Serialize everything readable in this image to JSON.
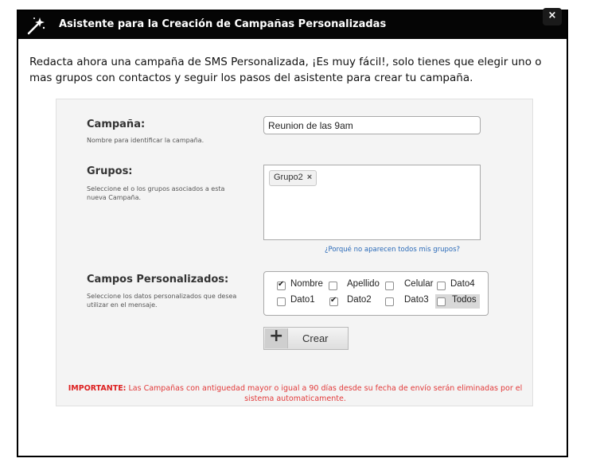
{
  "dialog": {
    "title": "Asistente para la Creación de Campañas Personalizadas",
    "close_label": "×"
  },
  "intro": "Redacta ahora una campaña de SMS Personalizada, ¡Es muy fácil!, solo tienes que elegir uno o mas grupos con contactos y seguir los pasos del asistente para crear tu campaña.",
  "form": {
    "campaign": {
      "label": "Campaña:",
      "help": "Nombre para identificar la campaña.",
      "value": "Reunion de las 9am"
    },
    "groups": {
      "label": "Grupos:",
      "help": "Seleccione el o los grupos asociados a esta nueva Campaña.",
      "selected": [
        {
          "name": "Grupo2",
          "remove": "×"
        }
      ],
      "why_link": "¿Porqué no aparecen todos mis grupos?"
    },
    "fields": {
      "label": "Campos Personalizados:",
      "help": "Seleccione los datos personalizados que desea utilizar en el mensaje.",
      "options": [
        {
          "label": "Nombre",
          "checked": true
        },
        {
          "label": "Apellido",
          "checked": false
        },
        {
          "label": "Celular",
          "checked": false
        },
        {
          "label": "Dato4",
          "checked": false
        },
        {
          "label": "Dato1",
          "checked": false
        },
        {
          "label": "Dato2",
          "checked": true
        },
        {
          "label": "Dato3",
          "checked": false
        },
        {
          "label": "Todos",
          "checked": false
        }
      ]
    },
    "submit": {
      "icon": "plus-icon",
      "label": "Crear"
    },
    "notice": {
      "prefix": "IMPORTANTE:",
      "text": "Las Campañas con antiguedad mayor o igual a 90 días desde su fecha de envío serán eliminadas por el sistema automaticamente."
    }
  },
  "colors": {
    "titlebar": "#050505",
    "link": "#2a6ab8",
    "warning": "#e23a3a"
  }
}
